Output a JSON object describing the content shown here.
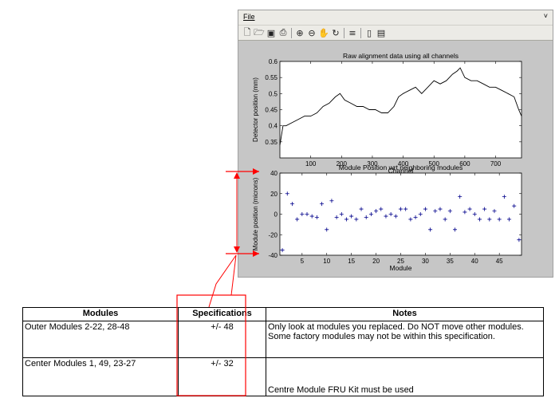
{
  "window": {
    "menu_file": "File",
    "menu_arrow": "˅",
    "toolbar_icons": [
      "new-file-icon",
      "open-folder-icon",
      "save-icon",
      "print-icon",
      "zoom-in-icon",
      "zoom-out-icon",
      "pan-hand-icon",
      "rotate-icon",
      "data-cursor-icon",
      "colorbar-icon",
      "legend-icon"
    ]
  },
  "chart_data": [
    {
      "type": "line",
      "title": "Raw alignment data using all channels",
      "xlabel": "Channel",
      "ylabel": "Detector position (mm)",
      "xlim": [
        0,
        784
      ],
      "ylim": [
        0.3,
        0.6
      ],
      "xticks": [
        100,
        200,
        300,
        400,
        500,
        600,
        700
      ],
      "yticks": [
        0.35,
        0.4,
        0.45,
        0.5,
        0.55,
        0.6
      ],
      "color": "#000000",
      "x": [
        0,
        10,
        20,
        40,
        60,
        80,
        100,
        120,
        140,
        160,
        180,
        195,
        210,
        230,
        250,
        270,
        290,
        310,
        330,
        350,
        370,
        385,
        400,
        420,
        440,
        460,
        480,
        500,
        520,
        540,
        560,
        575,
        585,
        600,
        620,
        640,
        660,
        680,
        700,
        720,
        740,
        760,
        775,
        784
      ],
      "y": [
        0.34,
        0.4,
        0.4,
        0.41,
        0.42,
        0.43,
        0.43,
        0.44,
        0.46,
        0.47,
        0.49,
        0.5,
        0.48,
        0.47,
        0.46,
        0.46,
        0.45,
        0.45,
        0.44,
        0.44,
        0.46,
        0.49,
        0.5,
        0.51,
        0.52,
        0.5,
        0.52,
        0.54,
        0.53,
        0.54,
        0.56,
        0.57,
        0.58,
        0.55,
        0.54,
        0.54,
        0.53,
        0.52,
        0.52,
        0.51,
        0.5,
        0.49,
        0.45,
        0.43
      ]
    },
    {
      "type": "scatter",
      "title": "Module Position wrt neighboring modules",
      "xlabel": "Module",
      "ylabel": "Module position (microns)",
      "xlim": [
        0.5,
        49.5
      ],
      "ylim": [
        -40,
        40
      ],
      "xticks": [
        5,
        10,
        15,
        20,
        25,
        30,
        35,
        40,
        45
      ],
      "yticks": [
        -40,
        -20,
        0,
        20,
        40
      ],
      "marker": "+",
      "color": "#00008b",
      "x": [
        1,
        2,
        3,
        4,
        5,
        6,
        7,
        8,
        9,
        10,
        11,
        12,
        13,
        14,
        15,
        16,
        17,
        18,
        19,
        20,
        21,
        22,
        23,
        24,
        25,
        26,
        27,
        28,
        29,
        30,
        31,
        32,
        33,
        34,
        35,
        36,
        37,
        38,
        39,
        40,
        41,
        42,
        43,
        44,
        45,
        46,
        47,
        48,
        49
      ],
      "y": [
        -35,
        20,
        10,
        -5,
        0,
        0,
        -2,
        -3,
        10,
        -15,
        13,
        -3,
        0,
        -5,
        -2,
        -5,
        5,
        -3,
        0,
        3,
        5,
        -2,
        0,
        -2,
        5,
        5,
        -5,
        -3,
        0,
        5,
        -15,
        3,
        5,
        -5,
        3,
        -15,
        17,
        2,
        5,
        0,
        -5,
        5,
        -5,
        3,
        -5,
        17,
        -5,
        8,
        -25
      ]
    }
  ],
  "table": {
    "headers": [
      "Modules",
      "Specifications",
      "Notes"
    ],
    "rows": [
      {
        "module": "Outer Modules 2-22, 28-48",
        "spec": "+/- 48",
        "notes": "Only look at modules you replaced. Do NOT move other modules. Some factory modules may not be within this specification."
      },
      {
        "module": "Center Modules 1, 49, 23-27",
        "spec": "+/- 32",
        "notes": "Centre Module FRU Kit must be used"
      }
    ]
  },
  "annotation_color": "#ff0000"
}
